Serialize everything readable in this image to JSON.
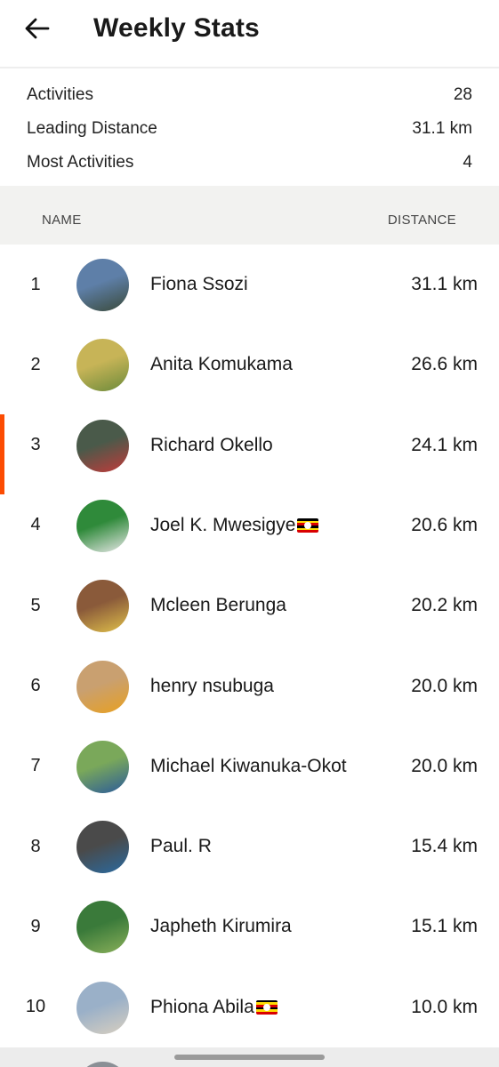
{
  "header": {
    "title": "Weekly Stats",
    "back_icon": "arrow-left-icon"
  },
  "summary": [
    {
      "label": "Activities",
      "value": "28"
    },
    {
      "label": "Leading Distance",
      "value": "31.1 km"
    },
    {
      "label": "Most Activities",
      "value": "4"
    }
  ],
  "table": {
    "col_name": "NAME",
    "col_distance": "DISTANCE"
  },
  "highlight_color": "#fc4c02",
  "rows": [
    {
      "rank": "1",
      "name": "Fiona Ssozi",
      "distance": "31.1 km",
      "colors": [
        "#5e7fa8",
        "#3a4a3a"
      ]
    },
    {
      "rank": "2",
      "name": "Anita Komukama",
      "distance": "26.6 km",
      "colors": [
        "#c7b457",
        "#6b8a3a"
      ]
    },
    {
      "rank": "3",
      "name": "Richard Okello",
      "distance": "24.1 km",
      "colors": [
        "#4a5a4a",
        "#c23a3a"
      ]
    },
    {
      "rank": "4",
      "name": "Joel K. Mwesigye",
      "distance": "20.6 km",
      "colors": [
        "#2f8a3a",
        "#e8e8e8"
      ],
      "flag": true
    },
    {
      "rank": "5",
      "name": "Mcleen Berunga",
      "distance": "20.2 km",
      "colors": [
        "#8a5a3a",
        "#e0c04a"
      ]
    },
    {
      "rank": "6",
      "name": "henry nsubuga",
      "distance": "20.0 km",
      "colors": [
        "#c9a070",
        "#e8a020"
      ]
    },
    {
      "rank": "7",
      "name": "Michael Kiwanuka-Okot",
      "distance": "20.0 km",
      "colors": [
        "#7aa85a",
        "#2a5a9a"
      ]
    },
    {
      "rank": "8",
      "name": "Paul. R",
      "distance": "15.4 km",
      "colors": [
        "#4a4a4a",
        "#2a6aa0"
      ]
    },
    {
      "rank": "9",
      "name": "Japheth Kirumira",
      "distance": "15.1 km",
      "colors": [
        "#3a7a3a",
        "#8ab05a"
      ]
    },
    {
      "rank": "10",
      "name": "Phiona Abila",
      "distance": "10.0 km",
      "colors": [
        "#9ab0c8",
        "#d8cfc0"
      ],
      "flag": true
    }
  ]
}
